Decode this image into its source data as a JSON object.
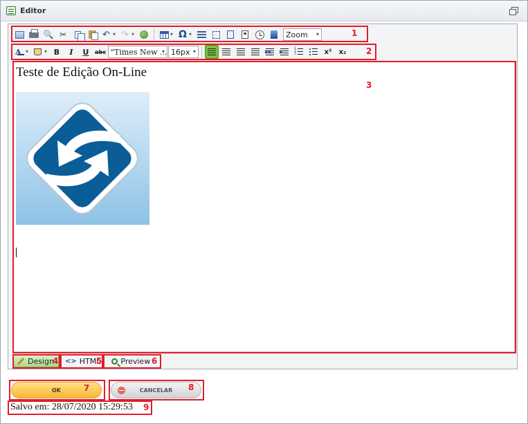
{
  "window": {
    "title": "Editor"
  },
  "toolbar": {
    "zoom_label": "Zoom",
    "font_family": "\"Times New ...",
    "font_size": "16px",
    "bold_label": "B",
    "italic_label": "I",
    "underline_label": "U",
    "strike_label": "abc",
    "font_color_label": "A",
    "special_char_label": "Ω",
    "superscript_label": "x²",
    "subscript_label": "x₂",
    "icons_row1": [
      "image-icon",
      "print-icon",
      "find-icon",
      "cut-icon",
      "copy-icon",
      "paste-icon",
      "undo-icon",
      "redo-icon",
      "hyperlink-icon",
      "table-icon",
      "special-char-icon",
      "horizontal-rule-icon",
      "select-all-icon",
      "paste-text-icon",
      "paste-word-icon",
      "clock-icon",
      "bookmark-icon"
    ],
    "icons_row2": [
      "font-color-icon",
      "highlight-icon",
      "bold-icon",
      "italic-icon",
      "underline-icon",
      "strikethrough-icon",
      "align-left-icon",
      "align-center-icon",
      "align-right-icon",
      "justify-icon",
      "outdent-icon",
      "indent-icon",
      "ordered-list-icon",
      "bullet-list-icon",
      "superscript-icon",
      "subscript-icon"
    ]
  },
  "document": {
    "heading": "Teste de Edição On-Line"
  },
  "modes": {
    "design": "Design",
    "html": "HTML",
    "preview": "Preview"
  },
  "actions": {
    "ok": "OK",
    "cancel": "CANCELAR"
  },
  "status": {
    "saved": "Salvo em: 28/07/2020 15:29:53"
  },
  "annotations": [
    "1",
    "2",
    "3",
    "4",
    "5",
    "6",
    "7",
    "8",
    "9"
  ],
  "colors": {
    "annotation": "#e11d2a",
    "active_tab": "#a9d98a",
    "ok_button": "#f7b733",
    "logo_blue": "#0b5d98"
  }
}
